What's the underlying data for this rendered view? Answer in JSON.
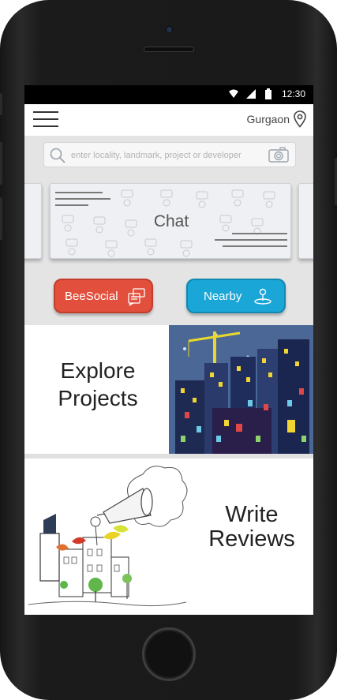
{
  "status_bar": {
    "time": "12:30"
  },
  "header": {
    "city": "Gurgaon"
  },
  "search": {
    "placeholder": "enter locality, landmark, project or developer"
  },
  "carousel": {
    "center_card_label": "Chat"
  },
  "actions": {
    "beesocial_label": "BeeSocial",
    "nearby_label": "Nearby"
  },
  "explore": {
    "line1": "Explore",
    "line2": "Projects"
  },
  "write": {
    "line1": "Write",
    "line2": "Reviews"
  },
  "colors": {
    "beesocial": "#e2503d",
    "nearby": "#1aa6d6",
    "section_bg": "#e4e4e4"
  }
}
